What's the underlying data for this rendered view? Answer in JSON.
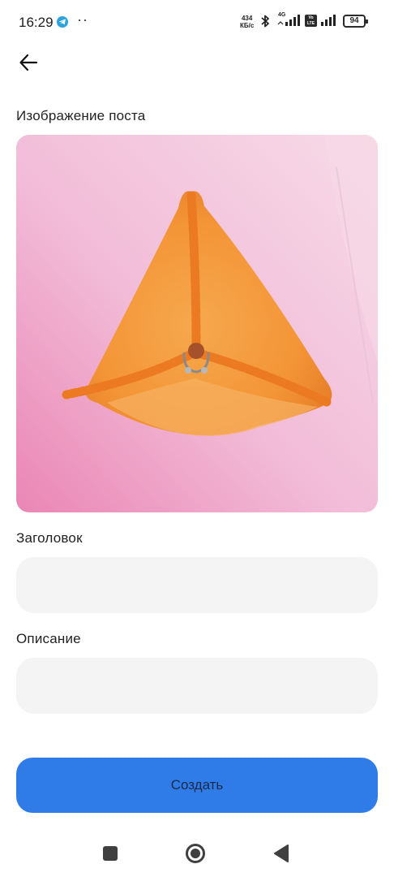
{
  "status_bar": {
    "time": "16:29",
    "dots": "··",
    "net_speed_value": "434",
    "net_speed_unit": "КБ/с",
    "network_type": "4G",
    "volte_label": "Vo LTE",
    "battery_level": "94",
    "icons": [
      "telegram-icon",
      "bluetooth-icon",
      "signal-icon",
      "volte-icon",
      "signal-icon",
      "battery-icon"
    ]
  },
  "header": {
    "back_icon": "arrow-left-icon"
  },
  "form": {
    "image_label": "Изображение поста",
    "title_label": "Заголовок",
    "title_value": "",
    "description_label": "Описание",
    "description_value": "",
    "submit_label": "Создать"
  },
  "colors": {
    "accent": "#2f7ce8",
    "field_background": "#f4f4f4",
    "image_background": "#f0b8d6",
    "samsa": "#f29a3c"
  },
  "nav_bar": {
    "icons": [
      "recents-square-icon",
      "home-circle-icon",
      "back-triangle-icon"
    ]
  }
}
